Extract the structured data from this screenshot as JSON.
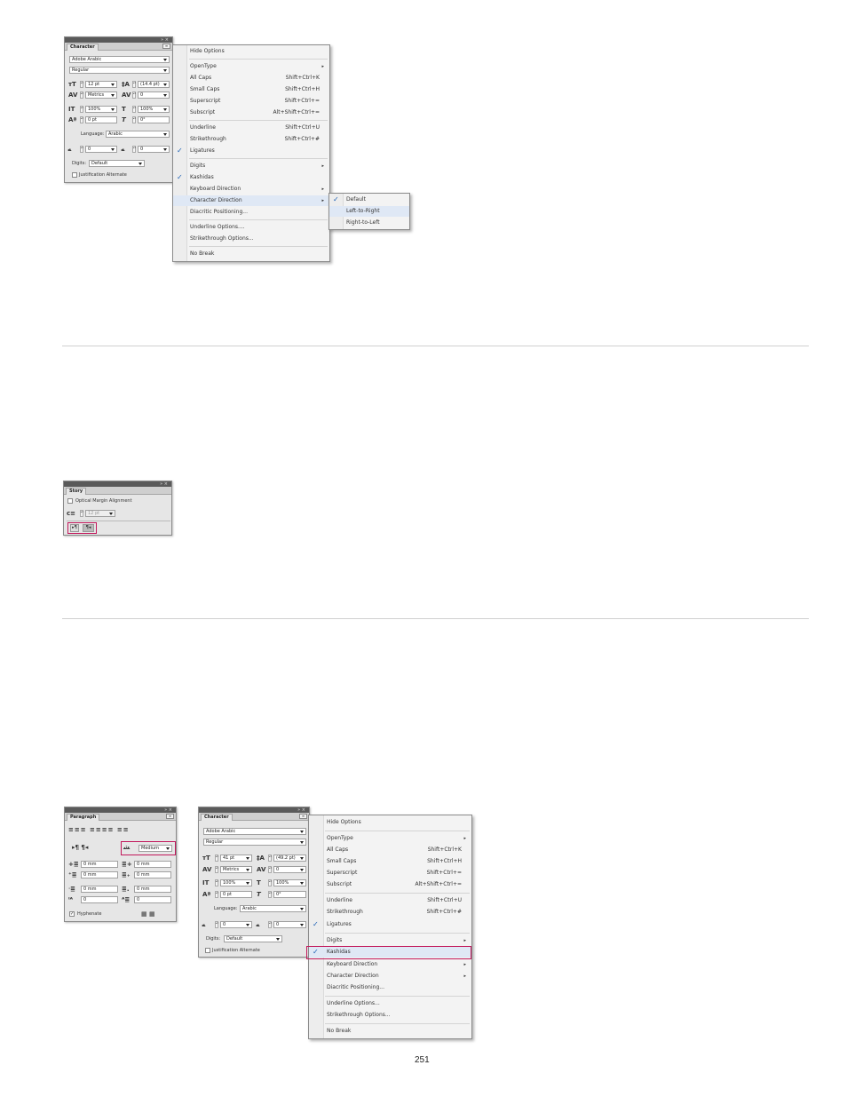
{
  "char1": {
    "tab": "Character",
    "font": "Adobe Arabic",
    "style": "Regular",
    "size": "12 pt",
    "leading": "(14.4 pt)",
    "kerning": "Metrics",
    "tracking": "0",
    "vscale": "100%",
    "hscale": "100%",
    "baseline": "0 pt",
    "skew": "0°",
    "language_label": "Language:",
    "language": "Arabic",
    "diacritic_x": "0",
    "diacritic_y": "0",
    "digits_label": "Digits:",
    "digits": "Default",
    "justification": "Justification Alternate",
    "panel_buttons": "»  ×"
  },
  "menu1": {
    "items": [
      {
        "label": "Hide Options"
      },
      {
        "label": "OpenType",
        "arrow": "▸"
      },
      {
        "label": "All Caps",
        "shortcut": "Shift+Ctrl+K"
      },
      {
        "label": "Small Caps",
        "shortcut": "Shift+Ctrl+H"
      },
      {
        "label": "Superscript",
        "shortcut": "Shift+Ctrl+="
      },
      {
        "label": "Subscript",
        "shortcut": "Alt+Shift+Ctrl+="
      },
      {
        "label": "Underline",
        "shortcut": "Shift+Ctrl+U"
      },
      {
        "label": "Strikethrough",
        "shortcut": "Shift+Ctrl+#"
      },
      {
        "label": "Ligatures",
        "check": "✓"
      },
      {
        "label": "Digits",
        "arrow": "▸"
      },
      {
        "label": "Kashidas",
        "check": "✓"
      },
      {
        "label": "Keyboard Direction",
        "arrow": "▸"
      },
      {
        "label": "Character Direction",
        "arrow": "▸"
      },
      {
        "label": "Diacritic Positioning..."
      },
      {
        "label": "Underline Options...."
      },
      {
        "label": "Strikethrough Options..."
      },
      {
        "label": "No Break"
      }
    ]
  },
  "submenu1": {
    "items": [
      {
        "label": "Default",
        "check": "✓"
      },
      {
        "label": "Left-to-Right"
      },
      {
        "label": "Right-to-Left"
      }
    ]
  },
  "story": {
    "tab": "Story",
    "optical": "Optical Margin Alignment",
    "size": "12 pt",
    "panel_buttons": "»  ×"
  },
  "para": {
    "tab": "Paragraph",
    "kashida": "Medium",
    "left_indent": "0 mm",
    "right_indent": "0 mm",
    "first_indent": "0 mm",
    "last_indent": "0 mm",
    "space_before": "0 mm",
    "space_after": "0 mm",
    "drop_lines": "0",
    "drop_chars": "0",
    "hyphenate": "Hyphenate",
    "panel_buttons": "»  ×"
  },
  "char2": {
    "tab": "Character",
    "font": "Adobe Arabic",
    "style": "Regular",
    "size": "41 pt",
    "leading": "(49.2 pt)",
    "kerning": "Metrics",
    "tracking": "0",
    "vscale": "100%",
    "hscale": "100%",
    "baseline": "0 pt",
    "skew": "0°",
    "language_label": "Language:",
    "language": "Arabic",
    "diacritic_x": "0",
    "diacritic_y": "0",
    "digits_label": "Digits:",
    "digits": "Default",
    "justification": "Justification Alternate",
    "panel_buttons": "»  ×"
  },
  "menu2": {
    "items": [
      {
        "label": "Hide Options"
      },
      {
        "label": "OpenType",
        "arrow": "▸"
      },
      {
        "label": "All Caps",
        "shortcut": "Shift+Ctrl+K"
      },
      {
        "label": "Small Caps",
        "shortcut": "Shift+Ctrl+H"
      },
      {
        "label": "Superscript",
        "shortcut": "Shift+Ctrl+="
      },
      {
        "label": "Subscript",
        "shortcut": "Alt+Shift+Ctrl+="
      },
      {
        "label": "Underline",
        "shortcut": "Shift+Ctrl+U"
      },
      {
        "label": "Strikethrough",
        "shortcut": "Shift+Ctrl+#"
      },
      {
        "label": "Ligatures",
        "check": "✓"
      },
      {
        "label": "Digits",
        "arrow": "▸"
      },
      {
        "label": "Kashidas",
        "check": "✓"
      },
      {
        "label": "Keyboard Direction",
        "arrow": "▸"
      },
      {
        "label": "Character Direction",
        "arrow": "▸"
      },
      {
        "label": "Diacritic Positioning..."
      },
      {
        "label": "Underline Options..."
      },
      {
        "label": "Strikethrough Options..."
      },
      {
        "label": "No Break"
      }
    ]
  },
  "page_number": "251"
}
